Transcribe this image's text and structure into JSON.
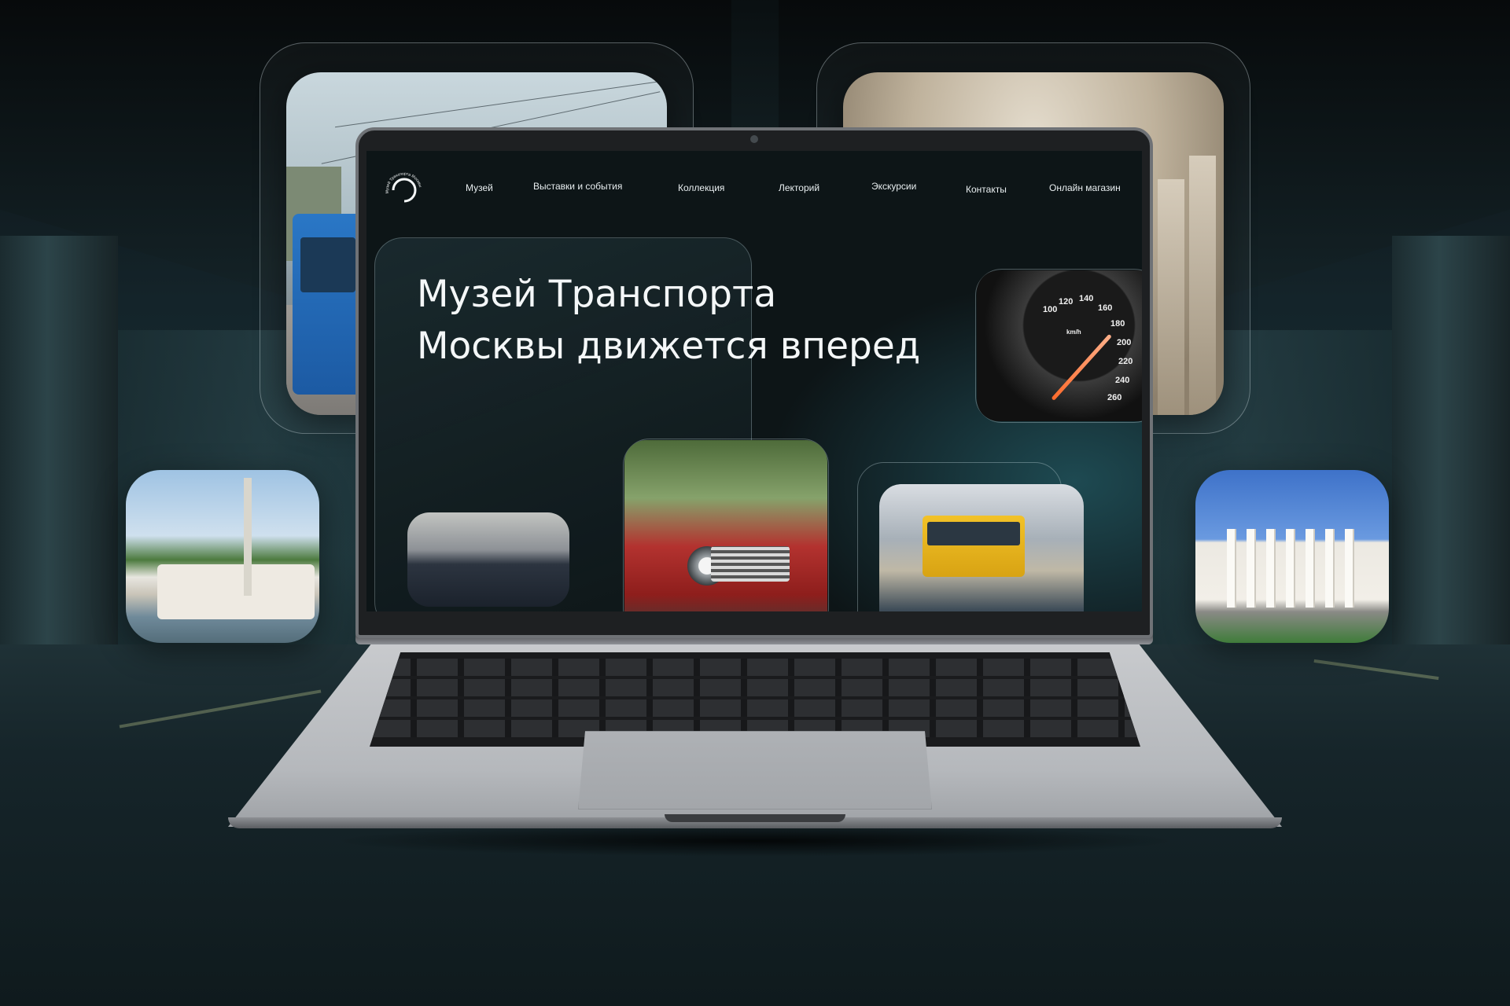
{
  "site": {
    "logo_text": "Музей Транспорта Москвы",
    "nav": [
      {
        "label": "Музей"
      },
      {
        "label": "Выставки и события"
      },
      {
        "label": "Коллекция"
      },
      {
        "label": "Лекторий"
      },
      {
        "label": "Экскурсии"
      },
      {
        "label": "Контакты"
      },
      {
        "label": "Онлайн магазин"
      }
    ],
    "hero": {
      "line1": "Музей Транспорта",
      "line2": "Москвы движется вперед"
    }
  },
  "speedometer": {
    "labels": [
      "100",
      "120",
      "140",
      "160",
      "180",
      "200",
      "220",
      "240",
      "260",
      "km/h"
    ]
  },
  "colors": {
    "screen_bg": "#0e1618",
    "accent_teal": "#1e4a52",
    "text": "#f4f7f8",
    "needle": "#ff6a2b"
  },
  "icons": {
    "logo": "circular-arc-logo"
  }
}
